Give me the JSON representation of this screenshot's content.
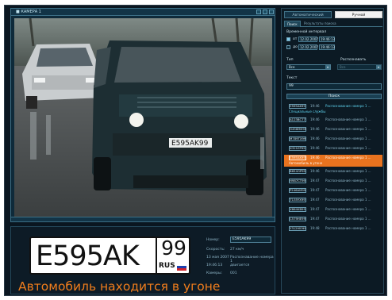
{
  "camera": {
    "label": "■ КАМЕРА 1"
  },
  "plate": {
    "main": "E595AK",
    "region": "99",
    "country": "RUS",
    "flag_colors": [
      "#ffffff",
      "#1c3fae",
      "#d2232a"
    ]
  },
  "info": {
    "number_label": "Номер:",
    "number_value": "E595AK99",
    "speed_label": "Скорость:",
    "speed_value": "27 км/ч",
    "event_date": "13 мая 2007",
    "event_title": "Распознавание номера 1",
    "event_time": "19:46:13",
    "event_status": "двигается",
    "camera_label": "Камеры:",
    "camera_value": "001"
  },
  "alert": {
    "text": "Автомобиль находится в угоне"
  },
  "right_panel": {
    "tabs": [
      "Автоматический",
      "Ручной"
    ],
    "active_tab_index": 1,
    "sub_tabs": [
      "Поиск",
      "Результаты поиска"
    ],
    "active_sub_tab_index": 0,
    "interval_label": "Временной интервал",
    "from_prefix": "от",
    "from_date": "12.02.2007",
    "from_time": "19:46:13",
    "to_prefix": "до",
    "to_date": "12.02.2007",
    "to_time": "19:46:13",
    "type_label": "Тип",
    "recognition_label": "Распознавать",
    "type_value": "Все",
    "recognition_value": "Все",
    "text_label": "Текст",
    "text_value": "99",
    "search_button": "Поиск"
  },
  "results": [
    {
      "plate": "E595AK99",
      "time": "19:46",
      "message": "Распознавание номера 1 ...",
      "message2": "Специальные службы",
      "highlight": false,
      "cyan": true
    },
    {
      "plate": "A123BC77",
      "time": "19:46",
      "message": "Распознавание номера 1 ...",
      "message2": "",
      "highlight": false,
      "cyan": false
    },
    {
      "plate": "O456MH99",
      "time": "19:46",
      "message": "Распознавание номера 1 ...",
      "message2": "",
      "highlight": false,
      "cyan": false
    },
    {
      "plate": "M789TX99",
      "time": "19:46",
      "message": "Распознавание номера 1 ...",
      "message2": "",
      "highlight": false,
      "cyan": false
    },
    {
      "plate": "K321EP99",
      "time": "19:46",
      "message": "Распознавание номера 1 ...",
      "message2": "",
      "highlight": false,
      "cyan": false
    },
    {
      "plate": "E595AK99",
      "time": "19:46",
      "message": "Распознавание номера 1 ...",
      "message2": "Автомобиль в угоне",
      "highlight": true,
      "cyan": false
    },
    {
      "plate": "B654OP99",
      "time": "19:46",
      "message": "Распознавание номера 1 ...",
      "message2": "",
      "highlight": false,
      "cyan": false
    },
    {
      "plate": "H987CT99",
      "time": "19:47",
      "message": "Распознавание номера 1 ...",
      "message2": "",
      "highlight": false,
      "cyan": false
    },
    {
      "plate": "P246AM99",
      "time": "19:47",
      "message": "Распознавание номера 1 ...",
      "message2": "",
      "highlight": false,
      "cyan": false
    },
    {
      "plate": "T135YX99",
      "time": "19:47",
      "message": "Распознавание номера 1 ...",
      "message2": "",
      "highlight": false,
      "cyan": false
    },
    {
      "plate": "X864KB99",
      "time": "19:47",
      "message": "Распознавание номера 1 ...",
      "message2": "",
      "highlight": false,
      "cyan": false
    },
    {
      "plate": "C579HE99",
      "time": "19:47",
      "message": "Распознавание номера 1 ...",
      "message2": "",
      "highlight": false,
      "cyan": false
    },
    {
      "plate": "Y312MO99",
      "time": "19:48",
      "message": "Распознавание номера 1 ...",
      "message2": "",
      "highlight": false,
      "cyan": false
    }
  ]
}
